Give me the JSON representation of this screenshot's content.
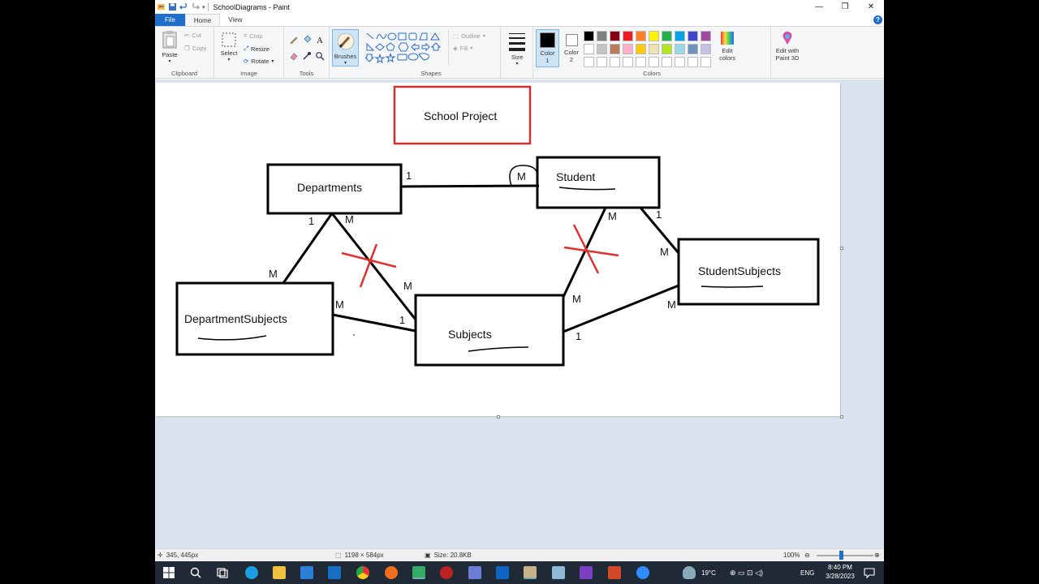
{
  "window": {
    "title": "SchoolDiagrams - Paint",
    "minimize": "—",
    "maximize": "❐",
    "close": "✕"
  },
  "tabs": [
    {
      "label": "File"
    },
    {
      "label": "Home"
    },
    {
      "label": "View"
    }
  ],
  "ribbon": {
    "clipboard": {
      "label": "Clipboard",
      "paste": "Paste",
      "cut": "Cut",
      "copy": "Copy"
    },
    "image": {
      "label": "Image",
      "select": "Select",
      "crop": "Crop",
      "resize": "Resize",
      "rotate": "Rotate"
    },
    "tools": {
      "label": "Tools"
    },
    "brushes": {
      "label": "Brushes"
    },
    "shapes": {
      "label": "Shapes",
      "outline": "Outline",
      "fill": "Fill"
    },
    "size": {
      "label": "Size"
    },
    "colors": {
      "label": "Colors",
      "color1": "Color\n1",
      "color1_a": "Color",
      "color1_b": "1",
      "color2_a": "Color",
      "color2_b": "2",
      "edit_colors_a": "Edit",
      "edit_colors_b": "colors",
      "paint3d_a": "Edit with",
      "paint3d_b": "Paint 3D",
      "palette_row1": [
        "#000000",
        "#7f7f7f",
        "#880015",
        "#ed1c24",
        "#ff7f27",
        "#fff200",
        "#22b14c",
        "#00a2e8",
        "#3f48cc",
        "#a349a4"
      ],
      "palette_row2": [
        "#ffffff",
        "#c3c3c3",
        "#b97a57",
        "#ffaec9",
        "#ffc90e",
        "#efe4b0",
        "#b5e61d",
        "#99d9ea",
        "#7092be",
        "#c8bfe7"
      ]
    }
  },
  "diagram": {
    "title": "School Project",
    "entities": {
      "departments": "Departments",
      "student": "Student",
      "department_subjects": "DepartmentSubjects",
      "subjects": "Subjects",
      "student_subjects": "StudentSubjects"
    },
    "cardinalities": {
      "dep_student_1": "1",
      "dep_student_m": "M",
      "dep_down_1": "1",
      "dep_down_m": "M",
      "depsub_top_m": "M",
      "subj_left_m": "M",
      "depsub_right_m": "M",
      "subj_left_1": "1",
      "student_down_m": "M",
      "student_right_1": "1",
      "studsub_left_m": "M",
      "subj_right_m": "M",
      "subj_right_1": "1",
      "studsub_lower_m": "M"
    }
  },
  "status": {
    "cursor_pos": "345, 445px",
    "dimensions": "1198 × 584px",
    "size": "Size: 20.8KB",
    "zoom": "100%"
  },
  "taskbar": {
    "weather": "19°C",
    "lang": "ENG",
    "time": "8:40 PM",
    "date": "3/28/2023"
  }
}
